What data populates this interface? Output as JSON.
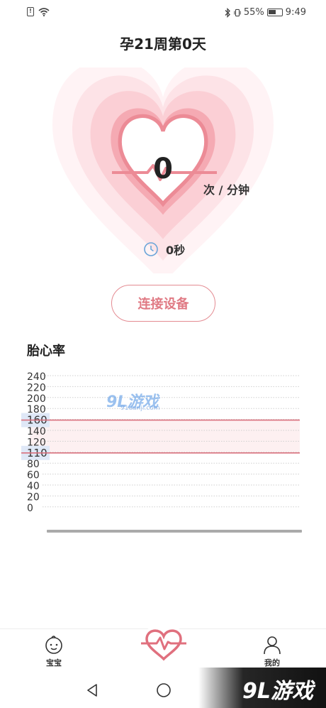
{
  "status_bar": {
    "battery": "55%",
    "time": "9:49"
  },
  "header": {
    "title": "孕21周第0天"
  },
  "monitor": {
    "bpm": "0",
    "unit": "次 / 分钟",
    "timer": "0秒"
  },
  "connect_button": {
    "label": "连接设备"
  },
  "section": {
    "title": "胎心率"
  },
  "chart_data": {
    "type": "line",
    "y_ticks": [
      "240",
      "220",
      "200",
      "180",
      "160",
      "140",
      "120",
      "110",
      "80",
      "60",
      "40",
      "20",
      "0"
    ],
    "y_tick_values": [
      240,
      220,
      200,
      180,
      160,
      140,
      120,
      110,
      80,
      60,
      40,
      20,
      0
    ],
    "ylim": [
      0,
      240
    ],
    "reference_lines": [
      160,
      110
    ],
    "highlighted_ticks": [
      "160",
      "110"
    ],
    "series": [],
    "grid": true,
    "colors": {
      "reference": "#d9707d",
      "band": "#fdf0f1",
      "highlight": "#dfe8f7",
      "grid": "#cfcfcf"
    }
  },
  "watermarks": {
    "top_main": "9L游戏",
    "top_sub": "91danji.com",
    "bottom": "9L游戏"
  },
  "tabs": [
    {
      "label": "宝宝",
      "icon": "baby-face-icon"
    },
    {
      "label": "",
      "icon": "heart-pulse-icon"
    },
    {
      "label": "我的",
      "icon": "person-icon"
    }
  ],
  "colors": {
    "accent": "#e07a84",
    "heart_outer": "#fde7ea",
    "heart_mid": "#f9c9cf",
    "heart_inner": "#f29aa4"
  }
}
